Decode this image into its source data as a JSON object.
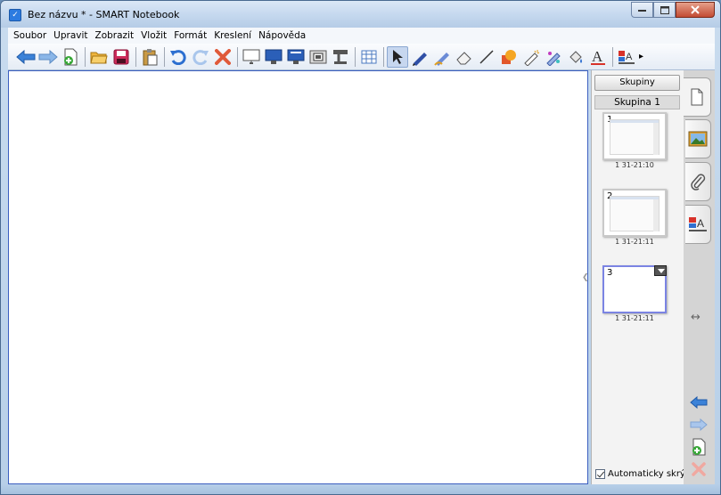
{
  "window": {
    "title": "Bez názvu * - SMART Notebook"
  },
  "menu": [
    "Soubor",
    "Upravit",
    "Zobrazit",
    "Vložit",
    "Formát",
    "Kreslení",
    "Nápověda"
  ],
  "toolbar": {
    "icons": [
      "back-arrow-icon",
      "forward-arrow-icon",
      "new-page-icon",
      "open-folder-icon",
      "save-icon",
      "paste-icon",
      "undo-icon",
      "redo-icon",
      "delete-icon",
      "screen-shade-icon",
      "full-screen-icon",
      "dual-display-icon",
      "screen-capture-icon",
      "document-camera-icon",
      "table-icon",
      "select-arrow-icon",
      "pen-icon",
      "creative-pen-icon",
      "eraser-icon",
      "line-icon",
      "shape-icon",
      "magic-pen-icon",
      "shape-recognition-pen-icon",
      "fill-icon",
      "text-icon",
      "properties-icon"
    ],
    "selected": "select-arrow-icon"
  },
  "panel": {
    "groups_button": "Skupiny",
    "group_label": "Skupina 1",
    "pages": [
      {
        "number": "1",
        "time": "1 31-21:10"
      },
      {
        "number": "2",
        "time": "1 31-21:11"
      },
      {
        "number": "3",
        "time": "1 31-21:11"
      }
    ],
    "auto_hide_label": "Automaticky skrýt",
    "auto_hide_checked": true
  },
  "sidetabs": [
    "page-sorter-icon",
    "gallery-icon",
    "attachments-icon",
    "properties-icon"
  ],
  "colors": {
    "accent_blue": "#2c7be0",
    "canvas_border": "#3c5fc0",
    "active_thumb_border": "#7b84e3",
    "delete_red": "#e05a3a"
  }
}
